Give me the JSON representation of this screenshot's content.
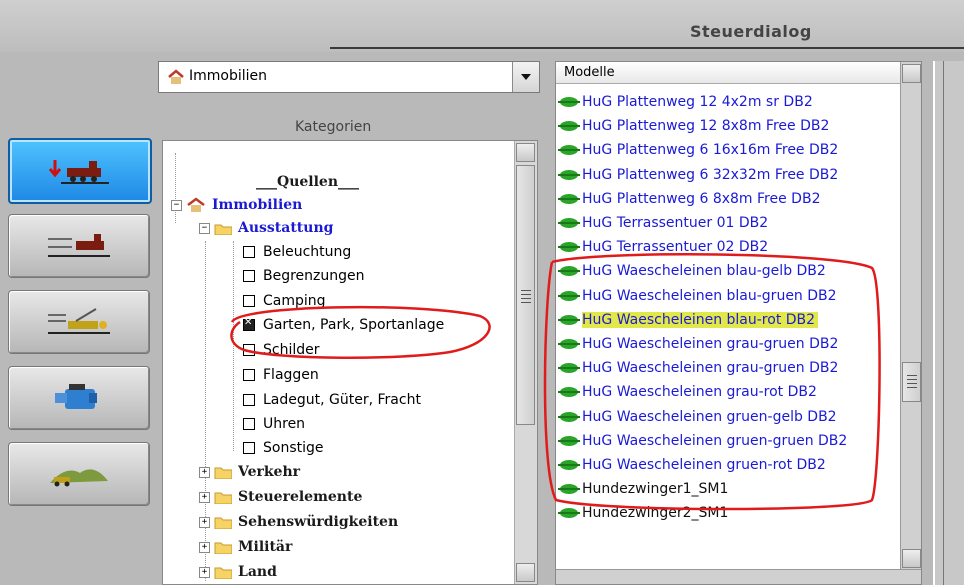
{
  "dialog": {
    "title": "Steuerdialog"
  },
  "category_select": {
    "value": "Immobilien"
  },
  "tree": {
    "label": "Kategorien",
    "items": [
      {
        "text": "___Quellen___",
        "kind": "section"
      },
      {
        "text": "Immobilien",
        "kind": "root"
      },
      {
        "text": "Ausstattung",
        "kind": "folder-open"
      },
      {
        "text": "Beleuchtung",
        "kind": "check",
        "checked": false
      },
      {
        "text": "Begrenzungen",
        "kind": "check",
        "checked": false
      },
      {
        "text": "Camping",
        "kind": "check",
        "checked": false
      },
      {
        "text": "Garten, Park, Sportanlage",
        "kind": "check",
        "checked": true
      },
      {
        "text": "Schilder",
        "kind": "check",
        "checked": false
      },
      {
        "text": "Flaggen",
        "kind": "check",
        "checked": false
      },
      {
        "text": "Ladegut, Güter, Fracht",
        "kind": "check",
        "checked": false
      },
      {
        "text": "Uhren",
        "kind": "check",
        "checked": false
      },
      {
        "text": "Sonstige",
        "kind": "check",
        "checked": false
      },
      {
        "text": "Verkehr",
        "kind": "folder"
      },
      {
        "text": "Steuerelemente",
        "kind": "folder"
      },
      {
        "text": "Sehenswürdigkeiten",
        "kind": "folder"
      },
      {
        "text": "Militär",
        "kind": "folder"
      },
      {
        "text": "Land",
        "kind": "folder"
      }
    ]
  },
  "models": {
    "header": "Modelle",
    "items": [
      {
        "text": "HuG Plattenweg 12 4x2m sr DB2"
      },
      {
        "text": "HuG Plattenweg 12 8x8m Free DB2"
      },
      {
        "text": "HuG Plattenweg 6 16x16m Free DB2"
      },
      {
        "text": "HuG Plattenweg 6 32x32m Free DB2"
      },
      {
        "text": "HuG Plattenweg 6 8x8m Free DB2"
      },
      {
        "text": "HuG Terrassentuer 01 DB2"
      },
      {
        "text": "HuG Terrassentuer 02 DB2"
      },
      {
        "text": "HuG Waescheleinen blau-gelb DB2"
      },
      {
        "text": "HuG Waescheleinen blau-gruen DB2"
      },
      {
        "text": "HuG Waescheleinen blau-rot DB2",
        "highlight": true
      },
      {
        "text": "HuG Waescheleinen grau-gruen DB2"
      },
      {
        "text": "HuG Waescheleinen grau-gruen DB2"
      },
      {
        "text": "HuG Waescheleinen grau-rot DB2"
      },
      {
        "text": "HuG Waescheleinen gruen-gelb DB2"
      },
      {
        "text": "HuG Waescheleinen gruen-gruen DB2"
      },
      {
        "text": "HuG Waescheleinen gruen-rot DB2"
      },
      {
        "text": "Hundezwinger1_SM1",
        "black": true
      },
      {
        "text": "Hundezwinger2_SM1",
        "black": true
      }
    ]
  },
  "colors": {
    "accent_button": "#1e88e5",
    "link_blue": "#1a1ad6",
    "highlight": "#e3e84a",
    "annotation_red": "#e01b1b"
  }
}
